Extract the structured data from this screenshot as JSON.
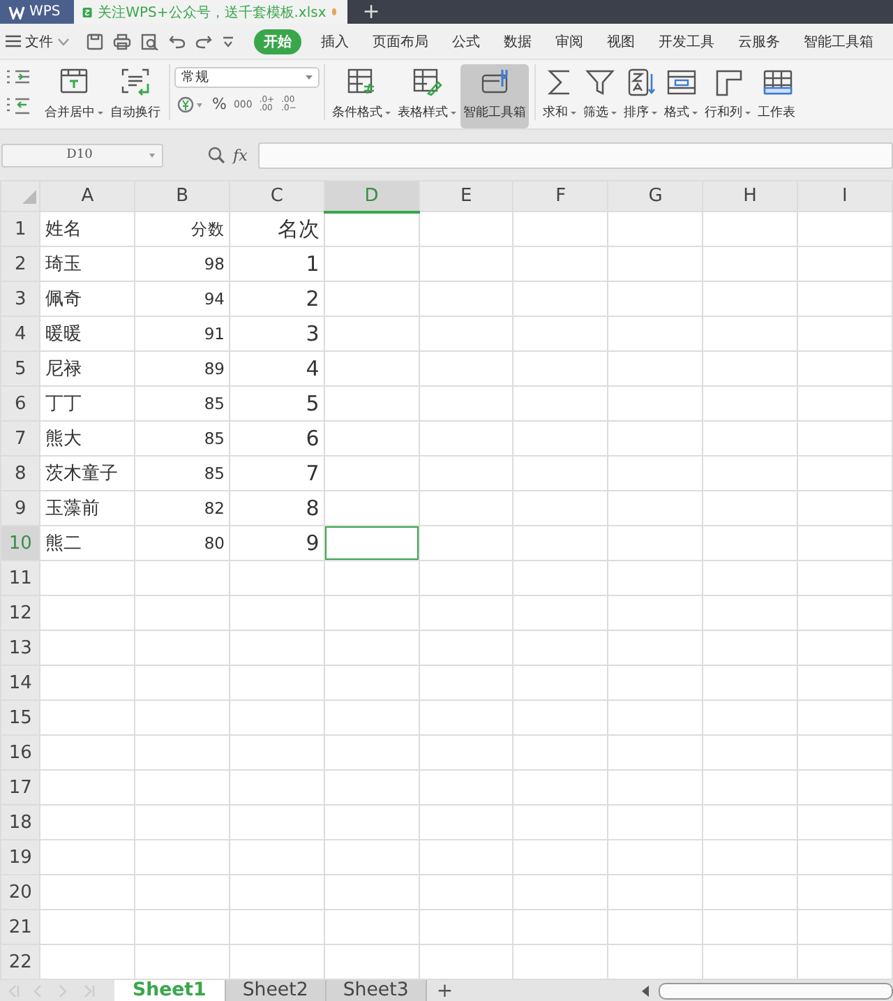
{
  "title_bar": {
    "app": "WPS",
    "tabs": [
      {
        "label": "关注WPS+公众号，送千套模板.xlsx",
        "selected": true,
        "modified": true
      }
    ],
    "add": "+"
  },
  "menu": {
    "file": "文件",
    "tabs": [
      {
        "label": "开始",
        "selected": true
      },
      {
        "label": "插入",
        "selected": false
      },
      {
        "label": "页面布局",
        "selected": false
      },
      {
        "label": "公式",
        "selected": false
      },
      {
        "label": "数据",
        "selected": false
      },
      {
        "label": "审阅",
        "selected": false
      },
      {
        "label": "视图",
        "selected": false
      },
      {
        "label": "开发工具",
        "selected": false
      },
      {
        "label": "云服务",
        "selected": false
      },
      {
        "label": "智能工具箱",
        "selected": false
      }
    ]
  },
  "ribbon": {
    "left": [
      {
        "kind": "merge",
        "label": "合并居中",
        "dropdown": true
      },
      {
        "kind": "wrap",
        "label": "自动换行",
        "dropdown": false
      }
    ],
    "number_format": "常规",
    "format_buttons": [
      {
        "kind": "currency"
      },
      {
        "kind": "text",
        "label": "%"
      },
      {
        "kind": "text",
        "label": "000"
      },
      {
        "kind": "stack",
        "label": ".0+",
        "label2": ".00"
      },
      {
        "kind": "stack",
        "label": ".00",
        "label2": ".0−"
      }
    ],
    "styles": [
      {
        "kind": "cond",
        "label": "条件格式",
        "dropdown": true,
        "pressed": false
      },
      {
        "kind": "table",
        "label": "表格样式",
        "dropdown": true,
        "pressed": false
      },
      {
        "kind": "toolbox",
        "label": "智能工具箱",
        "dropdown": false,
        "pressed": true
      }
    ],
    "tools": [
      {
        "kind": "sum",
        "label": "求和",
        "dropdown": true
      },
      {
        "kind": "filter",
        "label": "筛选",
        "dropdown": true
      },
      {
        "kind": "sort",
        "label": "排序",
        "dropdown": true
      },
      {
        "kind": "format",
        "label": "格式",
        "dropdown": true
      },
      {
        "kind": "rowcol",
        "label": "行和列",
        "dropdown": true
      },
      {
        "kind": "sheet",
        "label": "工作表",
        "dropdown": false
      }
    ]
  },
  "formula_bar": {
    "name_box": "D10",
    "fx": "fx"
  },
  "sheet": {
    "columns": [
      {
        "label": "A",
        "kind": "text",
        "selected": false
      },
      {
        "label": "B",
        "kind": "number",
        "selected": false
      },
      {
        "label": "C",
        "kind": "number_large",
        "selected": false
      },
      {
        "label": "D",
        "kind": "text",
        "selected": true
      },
      {
        "label": "E",
        "kind": "text",
        "selected": false
      },
      {
        "label": "F",
        "kind": "text",
        "selected": false
      },
      {
        "label": "G",
        "kind": "text",
        "selected": false
      },
      {
        "label": "H",
        "kind": "text",
        "selected": false
      },
      {
        "label": "I",
        "kind": "text",
        "selected": false
      }
    ],
    "rows": [
      {
        "label": "1",
        "selected": false,
        "cells": [
          "姓名",
          "分数",
          "名次"
        ]
      },
      {
        "label": "2",
        "selected": false,
        "cells": [
          "琦玉",
          "98",
          "1"
        ]
      },
      {
        "label": "3",
        "selected": false,
        "cells": [
          "佩奇",
          "94",
          "2"
        ]
      },
      {
        "label": "4",
        "selected": false,
        "cells": [
          "暖暖",
          "91",
          "3"
        ]
      },
      {
        "label": "5",
        "selected": false,
        "cells": [
          "尼禄",
          "89",
          "4"
        ]
      },
      {
        "label": "6",
        "selected": false,
        "cells": [
          "丁丁",
          "85",
          "5"
        ]
      },
      {
        "label": "7",
        "selected": false,
        "cells": [
          "熊大",
          "85",
          "6"
        ]
      },
      {
        "label": "8",
        "selected": false,
        "cells": [
          "茨木童子",
          "85",
          "7"
        ]
      },
      {
        "label": "9",
        "selected": false,
        "cells": [
          "玉藻前",
          "82",
          "8"
        ]
      },
      {
        "label": "10",
        "selected": true,
        "cells": [
          "熊二",
          "80",
          "9"
        ]
      },
      {
        "label": "11",
        "selected": false,
        "cells": []
      },
      {
        "label": "12",
        "selected": false,
        "cells": []
      },
      {
        "label": "13",
        "selected": false,
        "cells": []
      },
      {
        "label": "14",
        "selected": false,
        "cells": []
      },
      {
        "label": "15",
        "selected": false,
        "cells": []
      },
      {
        "label": "16",
        "selected": false,
        "cells": []
      },
      {
        "label": "17",
        "selected": false,
        "cells": []
      },
      {
        "label": "18",
        "selected": false,
        "cells": []
      },
      {
        "label": "19",
        "selected": false,
        "cells": []
      },
      {
        "label": "20",
        "selected": false,
        "cells": []
      },
      {
        "label": "21",
        "selected": false,
        "cells": []
      },
      {
        "label": "22",
        "selected": false,
        "cells": []
      }
    ]
  },
  "sheet_tabs": [
    {
      "label": "Sheet1",
      "selected": true
    },
    {
      "label": "Sheet2",
      "selected": false
    },
    {
      "label": "Sheet3",
      "selected": false
    }
  ],
  "add_sheet": "+"
}
